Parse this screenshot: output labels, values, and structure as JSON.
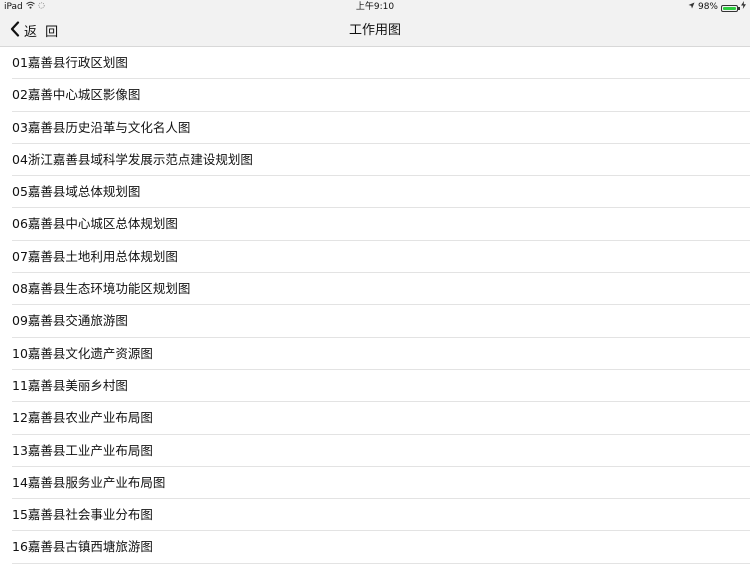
{
  "status_bar": {
    "device": "iPad",
    "time": "上午9:10",
    "battery": "98%",
    "battery_level": 0.98,
    "battery_color": "#2ecc40"
  },
  "nav_bar": {
    "back_label": "返 回",
    "title": "工作用图"
  },
  "list": {
    "items": [
      {
        "label": "01嘉善县行政区划图"
      },
      {
        "label": "02嘉善中心城区影像图"
      },
      {
        "label": "03嘉善县历史沿革与文化名人图"
      },
      {
        "label": "04浙江嘉善县域科学发展示范点建设规划图"
      },
      {
        "label": "05嘉善县域总体规划图"
      },
      {
        "label": "06嘉善县中心城区总体规划图"
      },
      {
        "label": "07嘉善县土地利用总体规划图"
      },
      {
        "label": "08嘉善县生态环境功能区规划图"
      },
      {
        "label": "09嘉善县交通旅游图"
      },
      {
        "label": "10嘉善县文化遗产资源图"
      },
      {
        "label": "11嘉善县美丽乡村图"
      },
      {
        "label": "12嘉善县农业产业布局图"
      },
      {
        "label": "13嘉善县工业产业布局图"
      },
      {
        "label": "14嘉善县服务业产业布局图"
      },
      {
        "label": "15嘉善县社会事业分布图"
      },
      {
        "label": "16嘉善县古镇西塘旅游图"
      }
    ]
  }
}
